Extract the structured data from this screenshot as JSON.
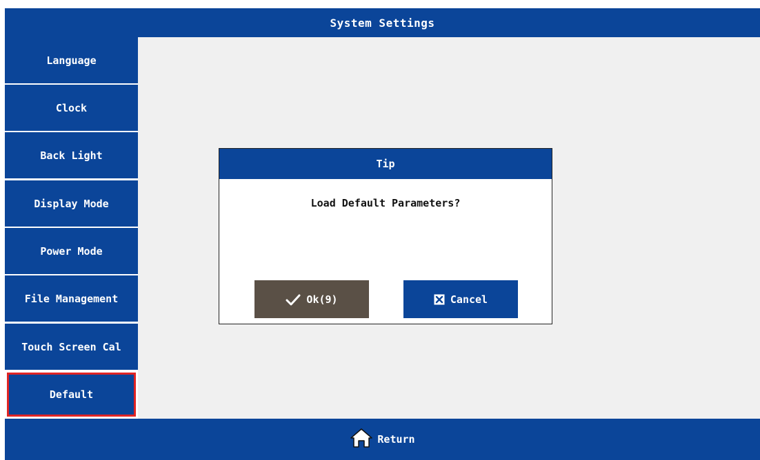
{
  "header": {
    "title": "System Settings"
  },
  "sidebar": {
    "items": [
      {
        "label": "Language"
      },
      {
        "label": "Clock"
      },
      {
        "label": "Back Light"
      },
      {
        "label": "Display Mode"
      },
      {
        "label": "Power Mode"
      },
      {
        "label": "File Management"
      },
      {
        "label": "Touch Screen Cal"
      },
      {
        "label": "Default",
        "selected": true
      }
    ]
  },
  "dialog": {
    "title": "Tip",
    "message": "Load Default Parameters?",
    "ok_label": "Ok(9)",
    "cancel_label": "Cancel",
    "ok_icon": "checkmark-icon",
    "cancel_icon": "x-box-icon"
  },
  "footer": {
    "return_label": "Return",
    "return_icon": "home-icon"
  },
  "colors": {
    "primary": "#0b4599",
    "ok_button": "#5a5046",
    "selection_border": "#e02424",
    "content_bg": "#f0f0f0"
  }
}
